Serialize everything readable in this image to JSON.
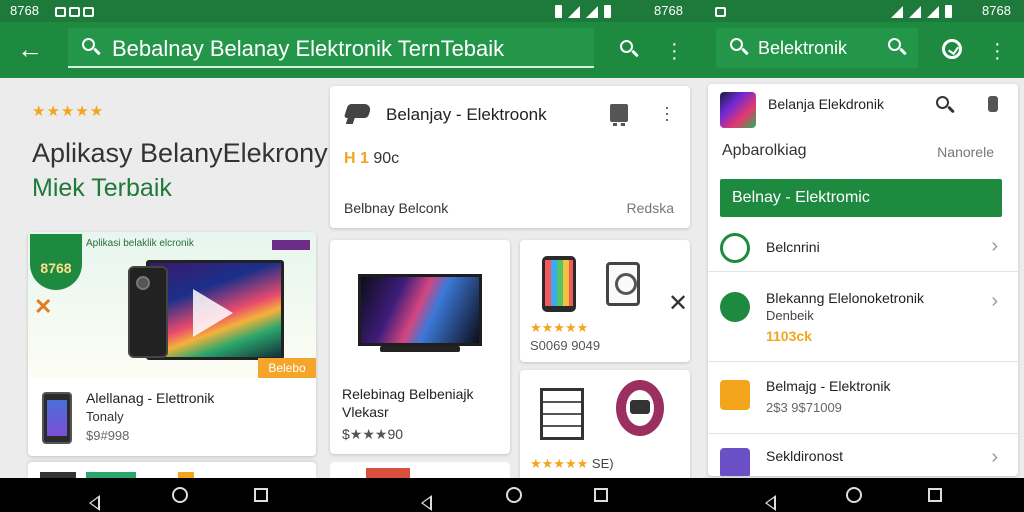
{
  "status_bar": {
    "time_left": "8768",
    "time_mid": "8768",
    "time_right": "8768"
  },
  "app_bar": {
    "search_main": "Bebalnay Belanay Elektronik TernTebaik",
    "search_secondary": "Belektronik"
  },
  "hero": {
    "rating_stars": "★★★★★",
    "title_line1": "Aplikasy BelanyElekrony",
    "title_line2": "Miek Terbaik"
  },
  "featured_card": {
    "banner_text": "Aplikasi belaklik elcronik",
    "badge_text": "8768",
    "cta": "Belebo",
    "product_name": "Alellanag - Elettronik",
    "product_sub": "Tonaly",
    "product_price": "$9#998"
  },
  "top_card": {
    "title": "Belanjay - Elektroonk",
    "price_highlight": "H 1",
    "price_rest": "90c",
    "footer_left": "Belbnay Belconk",
    "footer_right": "Redska"
  },
  "monitor_card": {
    "title_line1": "Relebinag Belbeniajk",
    "title_line2": "Vlekasr",
    "price_prefix": "$",
    "price_stars": "★★★",
    "price_suffix": "90"
  },
  "phone_card": {
    "stars": "★★★★★",
    "price": "S0069 9049"
  },
  "rack_card": {
    "stars": "★★★★★",
    "price": "SE)"
  },
  "side_panel": {
    "app_title": "Belanja Elekdronik",
    "subtitle": "Apbarolkiag",
    "subtitle_right": "Nanorele",
    "primary_button": "Belnay - Elektromic",
    "rows": [
      {
        "title": "Belcnrini",
        "sub": "",
        "price": "",
        "extra": ""
      },
      {
        "title": "Blekanng Elelonoketronik",
        "sub": "Denbeik",
        "price": "1103ck",
        "extra": ""
      },
      {
        "title": "Belmajg - Elektronik",
        "sub": "",
        "price": "",
        "extra": "2$3 9$71009"
      },
      {
        "title": "Sekldironost",
        "sub": "",
        "price": "",
        "extra": ""
      }
    ]
  },
  "colors": {
    "brand_green": "#1e8a40",
    "accent_orange": "#f3a51c",
    "purple_tag": "#6d2d87"
  }
}
